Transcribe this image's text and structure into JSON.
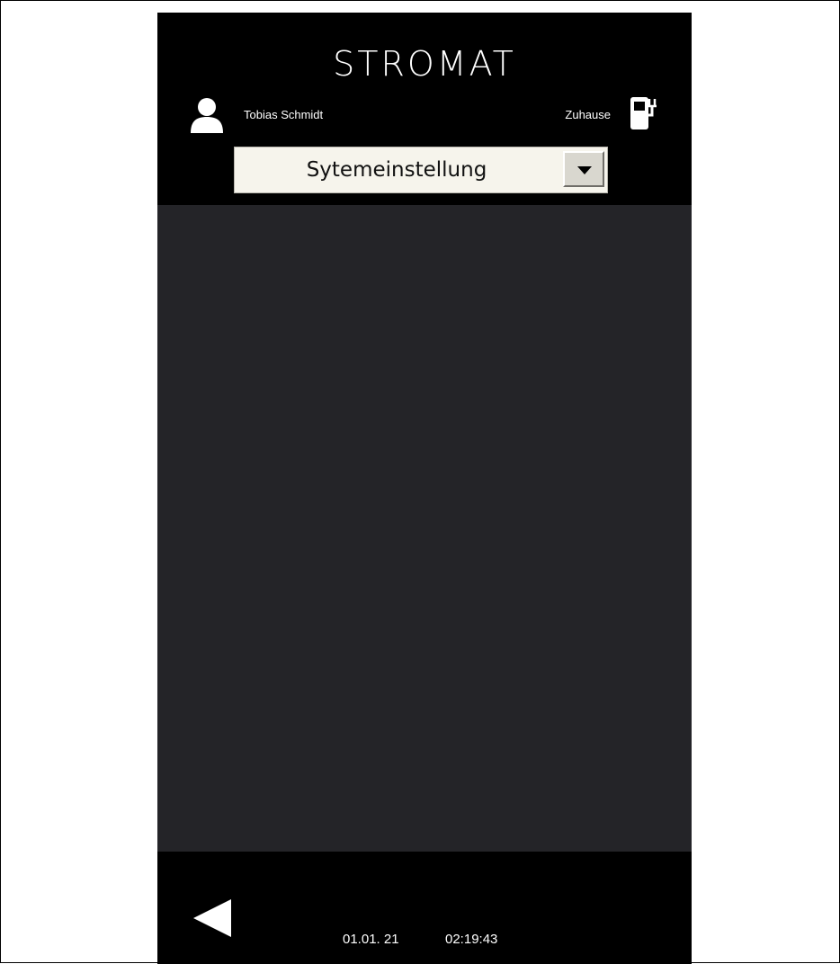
{
  "header": {
    "brand": "STROMAT",
    "user_name": "Tobias Schmidt",
    "location": "Zuhause"
  },
  "menu": {
    "selected": "Sytemeinstellung"
  },
  "footer": {
    "date": "01.01. 21",
    "time": "02:19:43"
  },
  "icons": {
    "user": "user-icon",
    "pump": "charging-station-icon",
    "back": "back-arrow-icon",
    "dropdown": "chevron-down-icon"
  },
  "colors": {
    "background": "#000000",
    "content": "#242428",
    "text": "#ffffff",
    "dropdown_bg": "#f6f4ec"
  }
}
